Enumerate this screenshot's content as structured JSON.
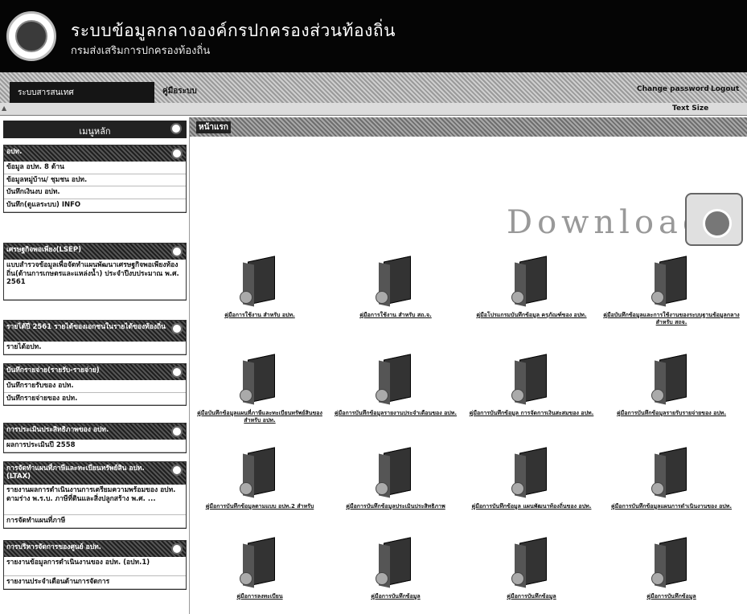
{
  "header": {
    "title": "ระบบข้อมูลกลางองค์กรปกครองส่วนท้องถิ่น",
    "subtitle": "กรมส่งเสริมการปกครองท้องถิ่น"
  },
  "nav": {
    "tab_home": "ระบบสารสนเทศ",
    "tab_manual": "คู่มือระบบ",
    "change_password": "Change password",
    "logout": "Logout",
    "text_size": "Text Size"
  },
  "sidebar": {
    "title": "เมนูหลัก",
    "sections": [
      {
        "title": "อปท.",
        "items": [
          "ข้อมูล อปท. 8 ด้าน",
          "ข้อมูลหมู่บ้าน/ ชุมชน อปท.",
          "บันทึกเงินงบ อปท.",
          "บันทึก(ดูแลระบบ) INFO"
        ]
      },
      {
        "title": "เศรษฐกิจพอเพียง(LSEP)",
        "items": [
          "แบบสำรวจข้อมูลเพื่อจัดทำแผนพัฒนาเศรษฐกิจพอเพียงท้องถิ่น(ด้านการเกษตรและแหล่งน้ำ) ประจำปีงบประมาณ พ.ศ. 2561"
        ]
      },
      {
        "title": "รายได้ปี 2561 รายได้ของเอกชนในรายได้ของท้องถิ่น",
        "items": [
          "รายได้อปท."
        ]
      },
      {
        "title": "บันทึกรายจ่าย(รายรับ-รายจ่าย)",
        "items": [
          "บันทึกรายรับของ อปท.",
          "บันทึกรายจ่ายของ อปท."
        ]
      },
      {
        "title": "การประเมินประสิทธิภาพของ อปท.",
        "items": [
          "ผลการประเมินปี 2558"
        ]
      },
      {
        "title": "การจัดทำแผนที่ภาษีและทะเบียนทรัพย์สิน อปท. (LTAX)",
        "items": [
          "รายงานผลการดำเนินงานการเตรียมความพร้อมของ อปท. ตามร่าง พ.ร.บ. ภาษีที่ดินและสิ่งปลูกสร้าง พ.ศ. ...",
          "การจัดทำแผนที่ภาษี"
        ]
      },
      {
        "title": "การบริหารจัดการของศูนย์ อปท.",
        "items": [
          "รายงานข้อมูลการดำเนินงานของ อปท. (อปท.1)",
          "รายงานประจำเดือนด้านการจัดการ"
        ]
      }
    ]
  },
  "content": {
    "title": "หน้าแรก",
    "download_label": "Download",
    "items": [
      "คู่มือการใช้งาน สำหรับ อปท.",
      "คู่มือการใช้งาน สำหรับ สถ.จ.",
      "คู่มือโปรแกรมบันทึกข้อมูล ครุภัณฑ์ของ อปท.",
      "คู่มือบันทึกข้อมูลและการใช้งานของระบบฐานข้อมูลกลาง สำหรับ สถจ.",
      "คู่มือบันทึกข้อมูลแผนที่ภาษีและทะเบียนทรัพย์สินของ สำหรับ อปท.",
      "คู่มือการบันทึกข้อมูลรายงานประจำเดือนของ อปท.",
      "คู่มือการบันทึกข้อมูล การจัดการเงินสะสมของ อปท.",
      "คู่มือการบันทึกข้อมูลรายรับรายจ่ายของ อปท.",
      "คู่มือการบันทึกข้อมูลตามแบบ อปท.2 สำหรับ",
      "คู่มือการบันทึกข้อมูลประเมินประสิทธิภาพ",
      "คู่มือการบันทึกข้อมูล แผนพัฒนาท้องถิ่นของ อปท.",
      "คู่มือการบันทึกข้อมูลแผนการดำเนินงานของ อปท.",
      "คู่มือการลงทะเบียน",
      "คู่มือการบันทึกข้อมูล",
      "คู่มือการบันทึกข้อมูล",
      "คู่มือการบันทึกข้อมูล"
    ]
  }
}
